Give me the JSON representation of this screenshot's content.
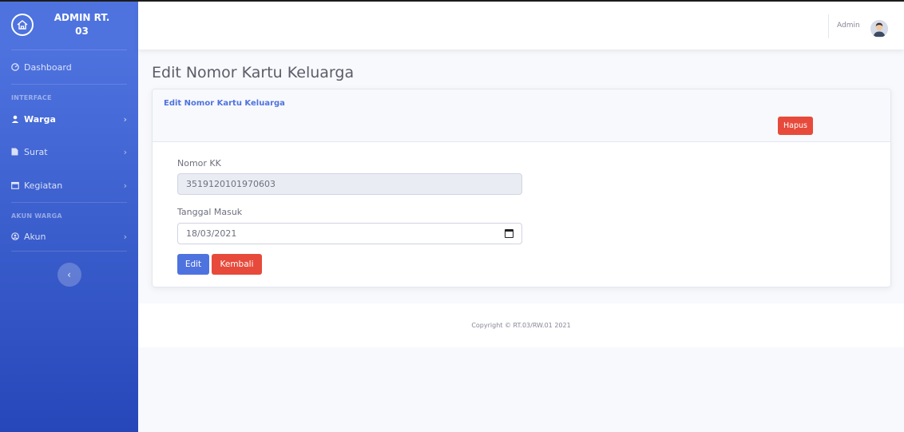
{
  "sidebar": {
    "brand_line1": "ADMIN RT.",
    "brand_line2": "03",
    "dashboard": "Dashboard",
    "heading_interface": "INTERFACE",
    "warga": "Warga",
    "surat": "Surat",
    "kegiatan": "Kegiatan",
    "heading_akun": "AKUN WARGA",
    "akun": "Akun"
  },
  "topbar": {
    "user_name": "Admin"
  },
  "main": {
    "page_title": "Edit Nomor Kartu Keluarga",
    "card_title": "Edit Nomor Kartu Keluarga",
    "hapus": "Hapus",
    "label_kk": "Nomor KK",
    "value_kk": "3519120101970603",
    "label_tanggal": "Tanggal Masuk",
    "value_tanggal": "18/03/2021",
    "btn_edit": "Edit",
    "btn_kembali": "Kembali"
  },
  "footer": {
    "text": "Copyright © RT.03/RW.01 2021"
  },
  "colors": {
    "primary": "#4e73df",
    "danger": "#e74a3b",
    "sidebar_bottom": "#2647b9"
  }
}
